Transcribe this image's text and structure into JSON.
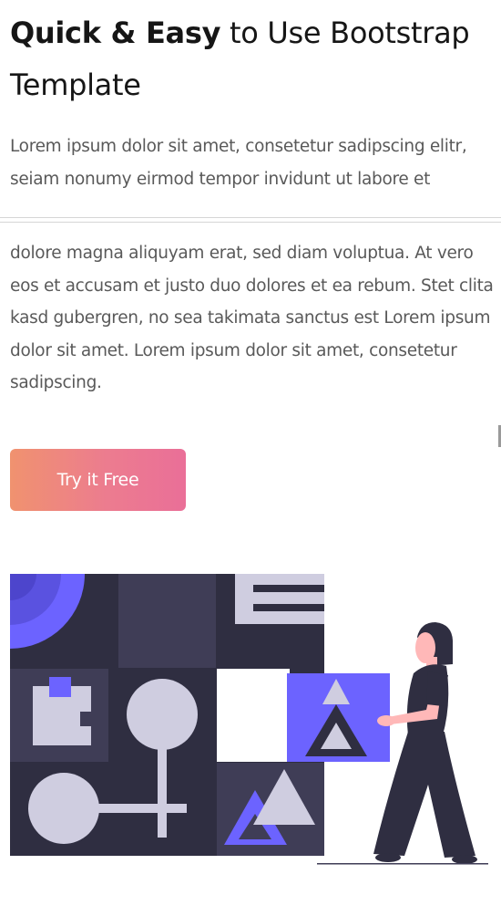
{
  "hero": {
    "headline_bold": "Quick & Easy",
    "headline_rest": " to Use Bootstrap Template",
    "paragraph_top": "Lorem ipsum dolor sit amet, consetetur sadipscing elitr, seiam nonumy eirmod tempor invidunt ut labore et",
    "paragraph_bottom": "dolore magna aliquyam erat, sed diam voluptua. At vero eos et accusam et justo duo dolores et ea rebum. Stet clita kasd gubergren, no sea takimata sanctus est Lorem ipsum dolor sit amet. Lorem ipsum dolor sit amet, consetetur sadipscing.",
    "cta_label": "Try it Free"
  },
  "colors": {
    "accent_purple": "#6c63ff",
    "dark_tile": "#3f3d56",
    "light_shape": "#cfcde0",
    "cta_gradient_start": "#f0926f",
    "cta_gradient_end": "#ea6f98"
  },
  "illustration": {
    "icon": "person-holding-shapes-illustration"
  }
}
